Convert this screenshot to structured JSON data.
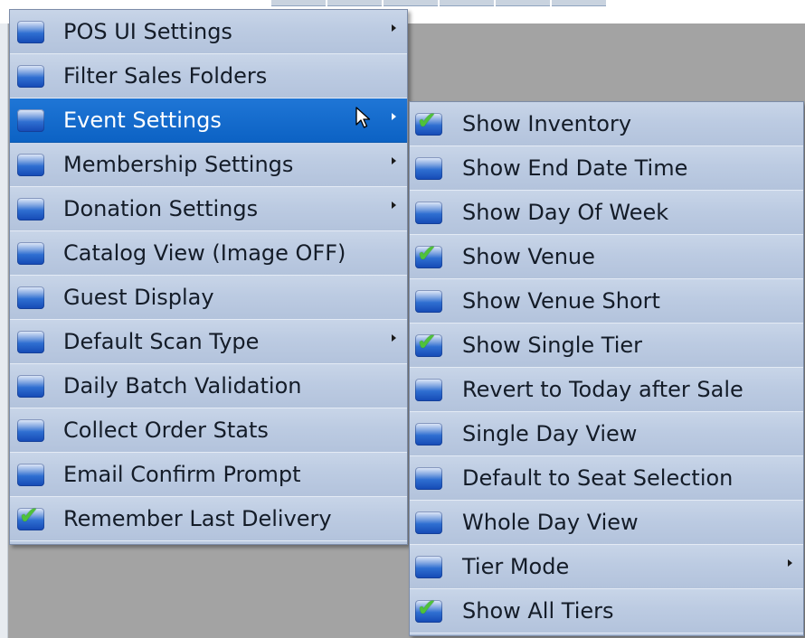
{
  "main_menu": {
    "items": [
      {
        "label": "POS UI Settings",
        "checked": false,
        "submenu": true,
        "highlighted": false
      },
      {
        "label": "Filter Sales Folders",
        "checked": false,
        "submenu": false,
        "highlighted": false
      },
      {
        "label": "Event Settings",
        "checked": false,
        "submenu": true,
        "highlighted": true
      },
      {
        "label": "Membership Settings",
        "checked": false,
        "submenu": true,
        "highlighted": false
      },
      {
        "label": "Donation Settings",
        "checked": false,
        "submenu": true,
        "highlighted": false
      },
      {
        "label": "Catalog View (Image OFF)",
        "checked": false,
        "submenu": false,
        "highlighted": false
      },
      {
        "label": "Guest Display",
        "checked": false,
        "submenu": false,
        "highlighted": false
      },
      {
        "label": "Default Scan Type",
        "checked": false,
        "submenu": true,
        "highlighted": false
      },
      {
        "label": "Daily Batch Validation",
        "checked": false,
        "submenu": false,
        "highlighted": false
      },
      {
        "label": "Collect Order Stats",
        "checked": false,
        "submenu": false,
        "highlighted": false
      },
      {
        "label": "Email Confirm Prompt",
        "checked": false,
        "submenu": false,
        "highlighted": false
      },
      {
        "label": "Remember Last Delivery",
        "checked": true,
        "submenu": false,
        "highlighted": false
      }
    ]
  },
  "event_settings_submenu": {
    "items": [
      {
        "label": "Show Inventory",
        "checked": true,
        "submenu": false
      },
      {
        "label": "Show End Date Time",
        "checked": false,
        "submenu": false
      },
      {
        "label": "Show Day Of Week",
        "checked": false,
        "submenu": false
      },
      {
        "label": "Show Venue",
        "checked": true,
        "submenu": false
      },
      {
        "label": "Show Venue Short",
        "checked": false,
        "submenu": false
      },
      {
        "label": "Show Single Tier",
        "checked": true,
        "submenu": false
      },
      {
        "label": "Revert to Today after Sale",
        "checked": false,
        "submenu": false
      },
      {
        "label": "Single Day View",
        "checked": false,
        "submenu": false
      },
      {
        "label": "Default to Seat Selection",
        "checked": false,
        "submenu": false
      },
      {
        "label": "Whole Day View",
        "checked": false,
        "submenu": false
      },
      {
        "label": "Tier Mode",
        "checked": false,
        "submenu": true
      },
      {
        "label": "Show All Tiers",
        "checked": true,
        "submenu": false
      }
    ]
  },
  "colors": {
    "menu_background": "#b9c8e0",
    "highlight": "#0c62c4",
    "app_background": "#a3a3a3",
    "check": "#4fc23a"
  }
}
